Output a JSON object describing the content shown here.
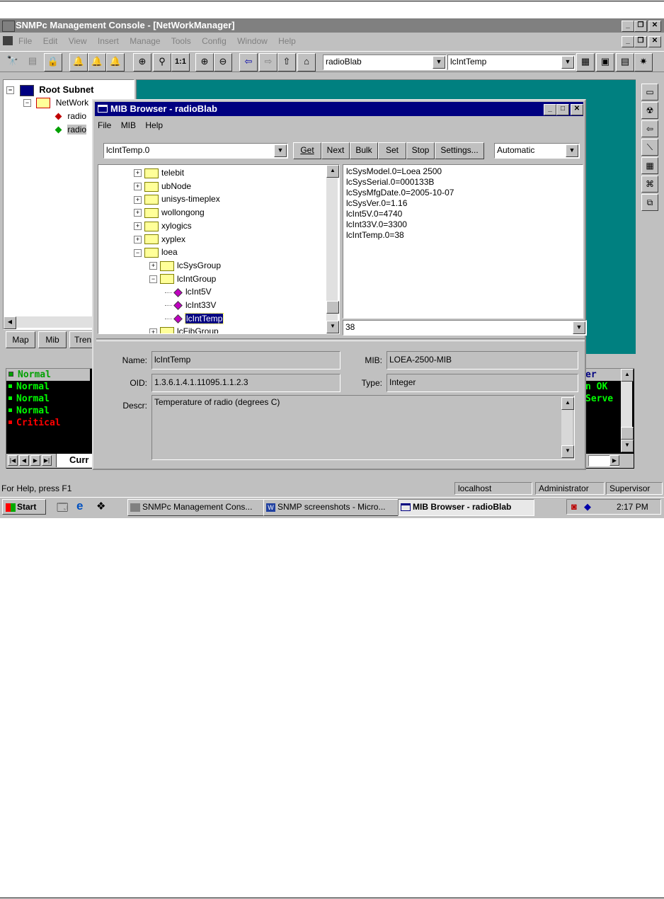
{
  "main_window": {
    "title": "SNMPc Management Console - [NetWorkManager]",
    "menu": [
      "File",
      "Edit",
      "View",
      "Insert",
      "Manage",
      "Tools",
      "Config",
      "Window",
      "Help"
    ],
    "toolbar_combo_1": "radioBlab",
    "toolbar_combo_2": "lcIntTemp",
    "zoom_label": "1:1"
  },
  "tree": {
    "root": "Root Subnet",
    "child": "NetWork",
    "leaf_1": "radio",
    "leaf_2": "radio"
  },
  "left_tabs": [
    "Map",
    "Mib",
    "Tren"
  ],
  "events": {
    "rows": [
      {
        "status": "Normal",
        "color": "#00ff00"
      },
      {
        "status": "Normal",
        "color": "#00ff00"
      },
      {
        "status": "Normal",
        "color": "#00ff00"
      },
      {
        "status": "Normal",
        "color": "#00ff00"
      },
      {
        "status": "Critical",
        "color": "#ff0000"
      }
    ],
    "right_header": "er",
    "right_rows": [
      "n OK",
      "Serve"
    ],
    "tab": "Curr"
  },
  "mib_browser": {
    "title": "MIB Browser - radioBlab",
    "menu": [
      "File",
      "MIB",
      "Help"
    ],
    "oid_combo": "lcIntTemp.0",
    "buttons": {
      "get": "Get",
      "next": "Next",
      "bulk": "Bulk",
      "set": "Set",
      "stop": "Stop",
      "settings": "Settings..."
    },
    "mode_combo": "Automatic",
    "tree": [
      {
        "label": "telebit",
        "type": "folder",
        "level": 0
      },
      {
        "label": "ubNode",
        "type": "folder",
        "level": 0
      },
      {
        "label": "unisys-timeplex",
        "type": "folder",
        "level": 0
      },
      {
        "label": "wollongong",
        "type": "folder",
        "level": 0
      },
      {
        "label": "xylogics",
        "type": "folder",
        "level": 0
      },
      {
        "label": "xyplex",
        "type": "folder",
        "level": 0
      },
      {
        "label": "loea",
        "type": "open-folder",
        "level": 0
      },
      {
        "label": "lcSysGroup",
        "type": "folder",
        "level": 1
      },
      {
        "label": "lcIntGroup",
        "type": "open-folder",
        "level": 1
      },
      {
        "label": "lcInt5V",
        "type": "leaf",
        "level": 2
      },
      {
        "label": "lcInt33V",
        "type": "leaf",
        "level": 2
      },
      {
        "label": "lcIntTemp",
        "type": "leaf-selected",
        "level": 2
      },
      {
        "label": "lcFibGroup",
        "type": "folder",
        "level": 1
      }
    ],
    "results": [
      "lcSysModel.0=Loea 2500",
      "lcSysSerial.0=000133B",
      "lcSysMfgDate.0=2005-10-07",
      "lcSysVer.0=1.16",
      "lcInt5V.0=4740",
      "lcInt33V.0=3300",
      "lcIntTemp.0=38"
    ],
    "value_combo": "38",
    "details": {
      "name_label": "Name:",
      "name": "lcIntTemp",
      "mib_label": "MIB:",
      "mib": "LOEA-2500-MIB",
      "oid_label": "OID:",
      "oid": "1.3.6.1.4.1.11095.1.1.2.3",
      "type_label": "Type:",
      "type": "Integer",
      "descr_label": "Descr:",
      "descr": "Temperature of radio (degrees C)"
    }
  },
  "status_bar": {
    "help": "For Help, press F1",
    "host": "localhost",
    "user": "Administrator",
    "role": "Supervisor"
  },
  "taskbar": {
    "start": "Start",
    "tasks": [
      "SNMPc Management Cons...",
      "SNMP screenshots - Micro...",
      "MIB Browser - radioBlab"
    ],
    "clock": "2:17 PM"
  }
}
